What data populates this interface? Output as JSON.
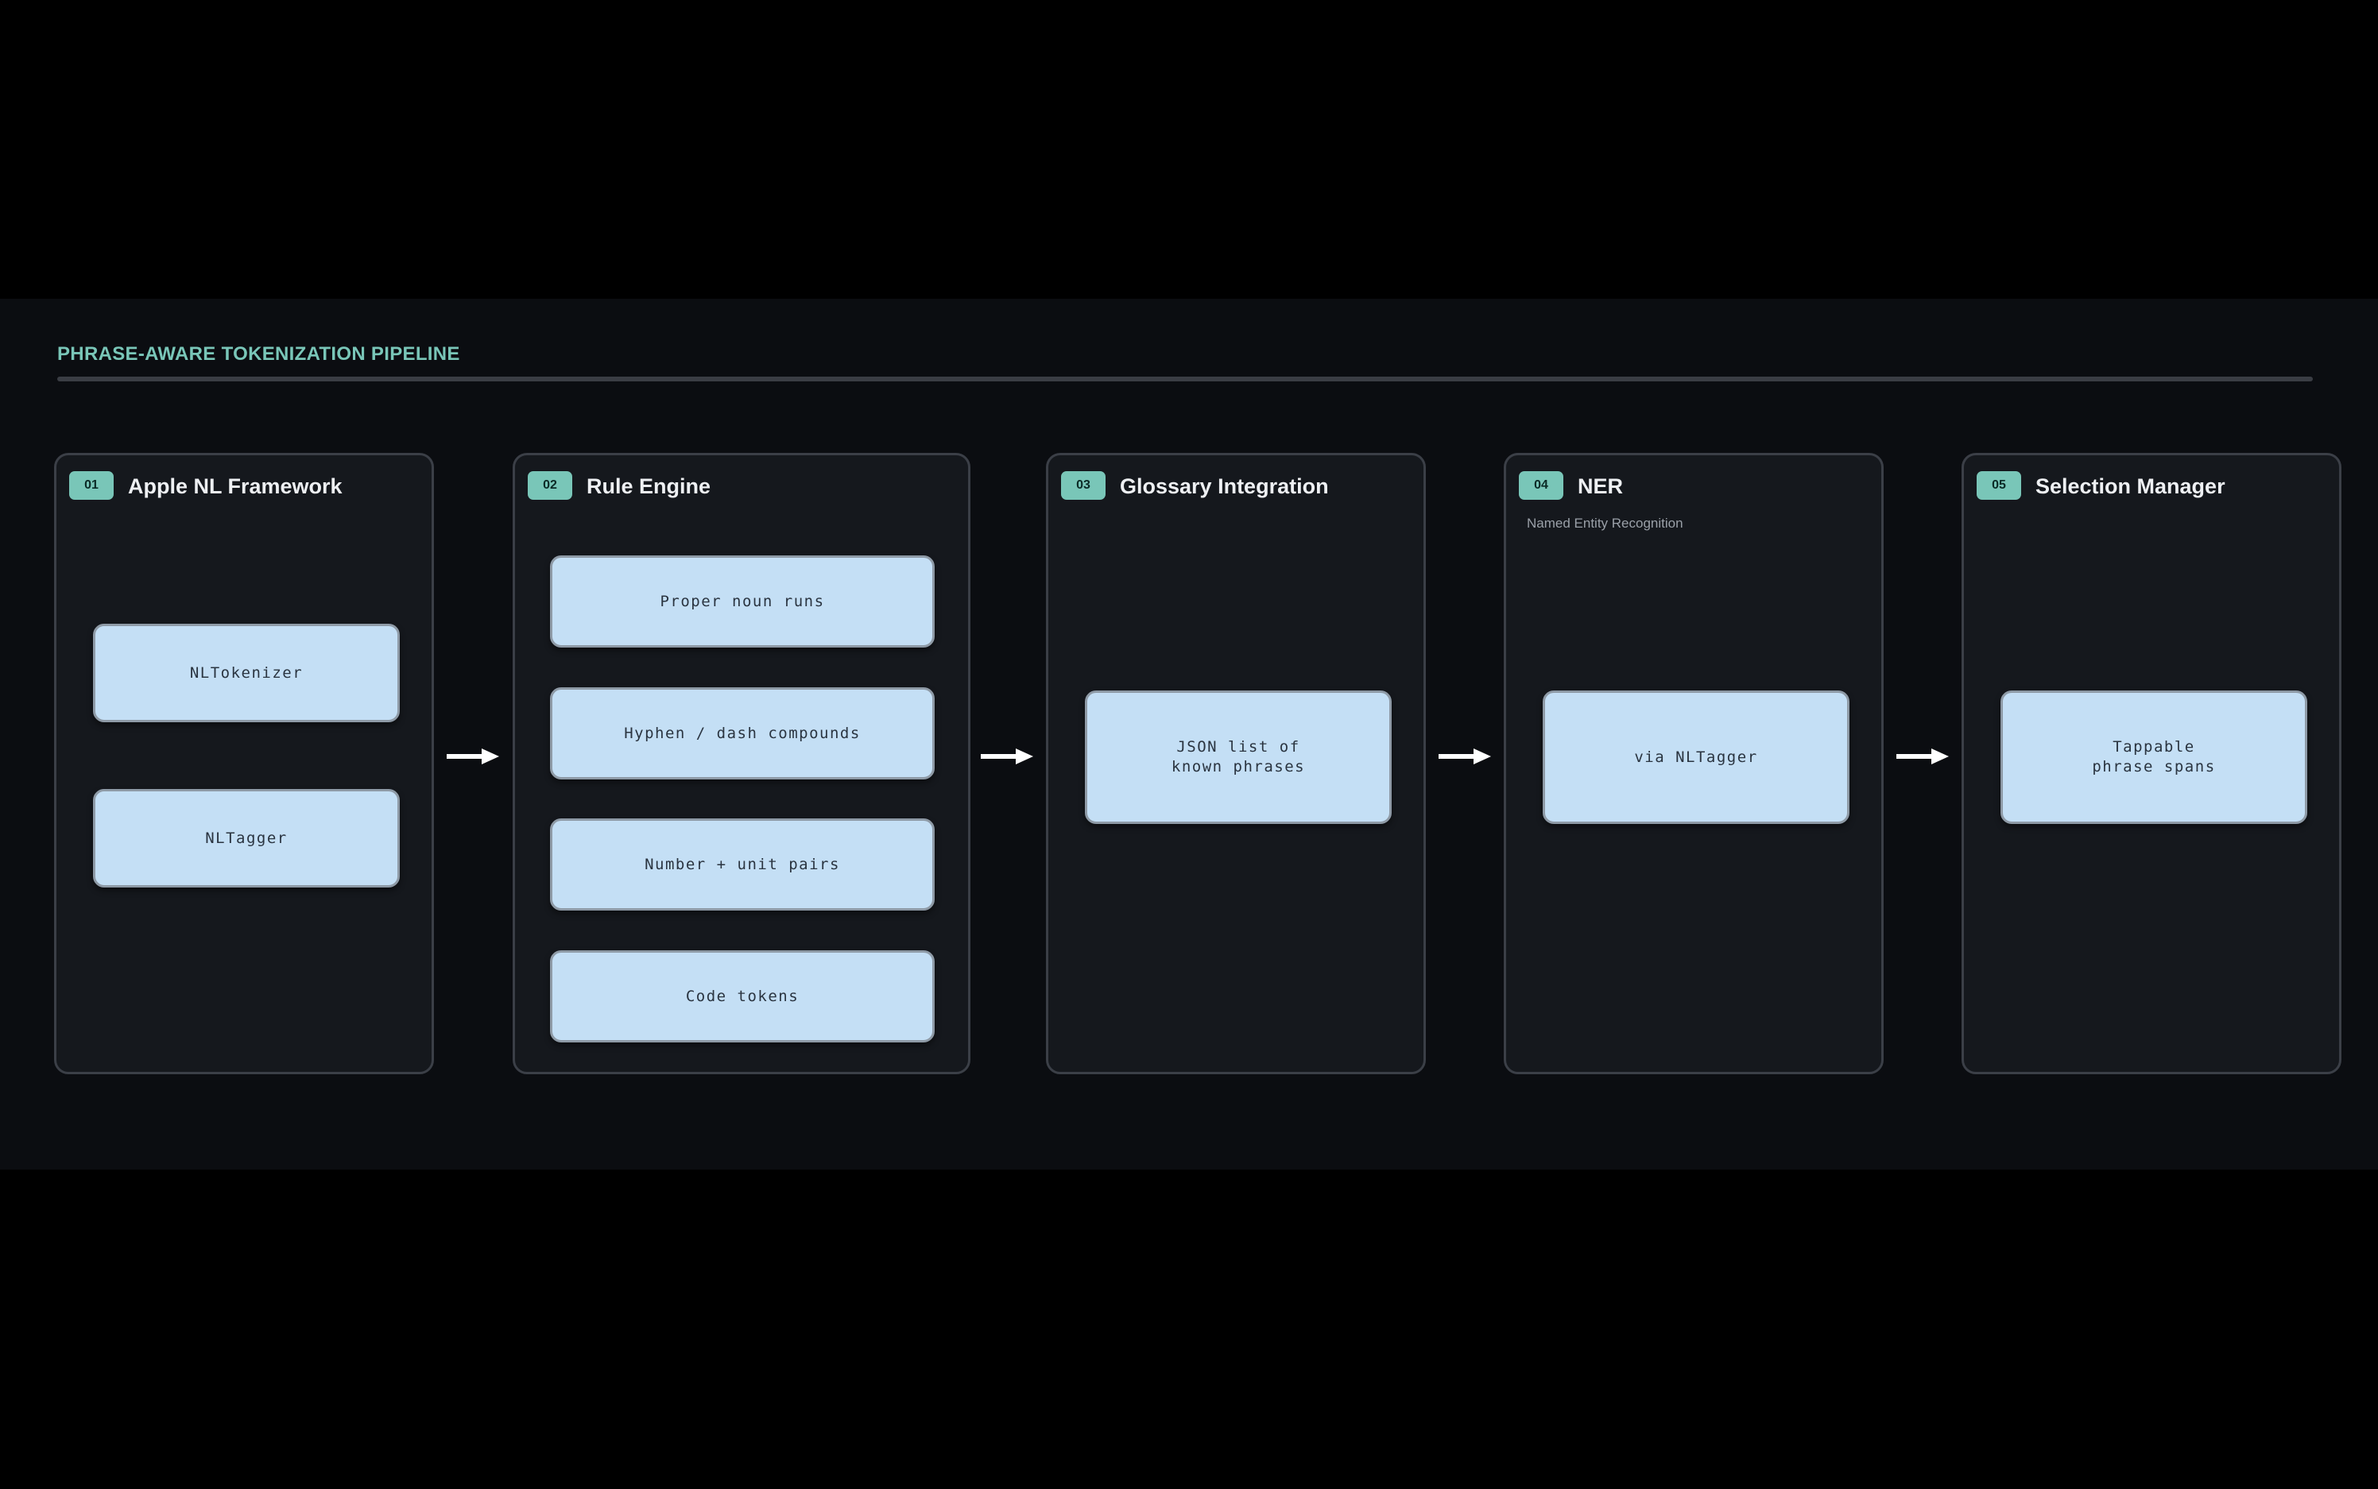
{
  "header": {
    "title": "PHRASE-AWARE TOKENIZATION PIPELINE"
  },
  "stages": [
    {
      "number": "01",
      "title": "Apple NL Framework",
      "subtitle": "",
      "nodes": [
        "NLTokenizer",
        "NLTagger"
      ]
    },
    {
      "number": "02",
      "title": "Rule Engine",
      "subtitle": "",
      "nodes": [
        "Proper noun runs",
        "Hyphen / dash compounds",
        "Number + unit pairs",
        "Code tokens"
      ]
    },
    {
      "number": "03",
      "title": "Glossary Integration",
      "subtitle": "",
      "nodes": [
        "JSON list of\nknown phrases"
      ]
    },
    {
      "number": "04",
      "title": "NER",
      "subtitle": "Named Entity Recognition",
      "nodes": [
        "via NLTagger"
      ]
    },
    {
      "number": "05",
      "title": "Selection Manager",
      "subtitle": "",
      "nodes": [
        "Tappable\nphrase spans"
      ]
    }
  ],
  "colors": {
    "accent": "#79c6b8",
    "node_fill": "#c4dff5",
    "panel": "#15181d",
    "background": "#0b0d11"
  }
}
